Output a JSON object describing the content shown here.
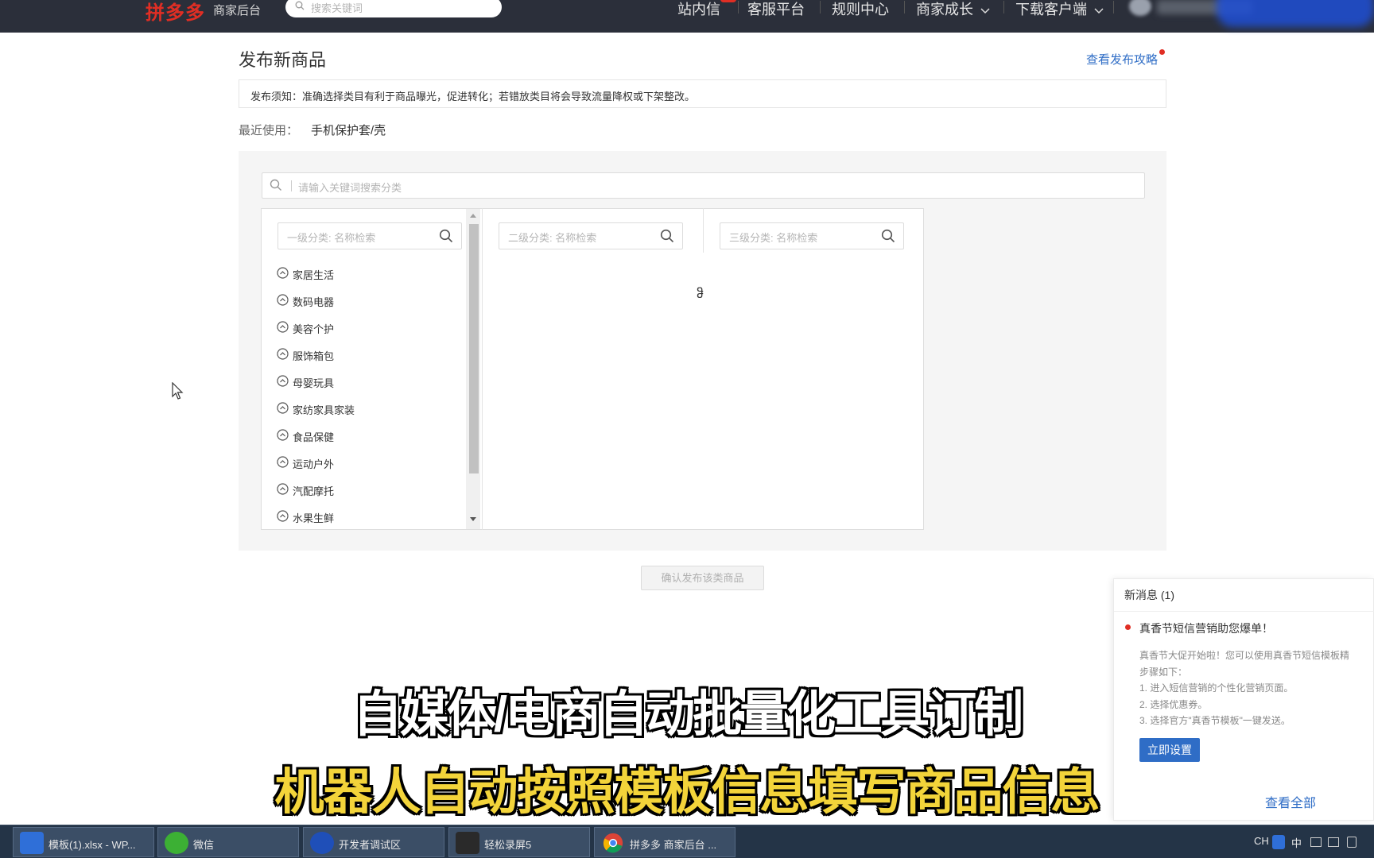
{
  "header": {
    "logo": "拼多多",
    "logo_sub": "商家后台",
    "search_placeholder": "搜索关键词",
    "nav": [
      "站内信",
      "客服平台",
      "规则中心",
      "商家成长",
      "下载客户端"
    ]
  },
  "page": {
    "title": "发布新商品",
    "guide_link": "查看发布攻略",
    "notice": "发布须知：准确选择类目有利于商品曝光，促进转化；若错放类目将会导致流量降权或下架整改。",
    "recent_label": "最近使用：",
    "recent_value": "手机保护套/壳",
    "category_search_placeholder": "请输入关键词搜索分类",
    "level_inputs": [
      "一级分类: 名称检索",
      "二级分类: 名称检索",
      "三级分类: 名称检索"
    ],
    "categories": [
      "家居生活",
      "数码电器",
      "美容个护",
      "服饰箱包",
      "母婴玩具",
      "家纺家具家装",
      "食品保健",
      "运动户外",
      "汽配摩托",
      "水果生鲜"
    ],
    "confirm_button": "确认发布该类商品",
    "cursor_mark": "ჵ"
  },
  "message": {
    "header": "新消息 (1)",
    "title": "真香节短信营销助您爆单！",
    "body": [
      "真香节大促开始啦！您可以使用真香节短信模板精",
      "步骤如下：",
      "1. 进入短信营销的个性化营销页面。",
      "2. 选择优惠券。",
      "3. 选择官方\"真香节模板\"一键发送。"
    ],
    "action": "立即设置",
    "view_all": "查看全部"
  },
  "subtitles": {
    "line1": "自媒体/电商自动批量化工具订制",
    "line2": "机器人自动按照模板信息填写商品信息"
  },
  "taskbar": {
    "tasks": [
      "模板(1).xlsx - WP...",
      "微信",
      "开发者调试区",
      "轻松录屏5",
      "拼多多 商家后台 ..."
    ],
    "tray": [
      "CH",
      "中"
    ]
  },
  "colors": {
    "accent_blue": "#2f6dc6",
    "brand_red": "#e02e24",
    "topbar": "#2b2f3a",
    "subtitle_yellow": "#f3d43a"
  }
}
